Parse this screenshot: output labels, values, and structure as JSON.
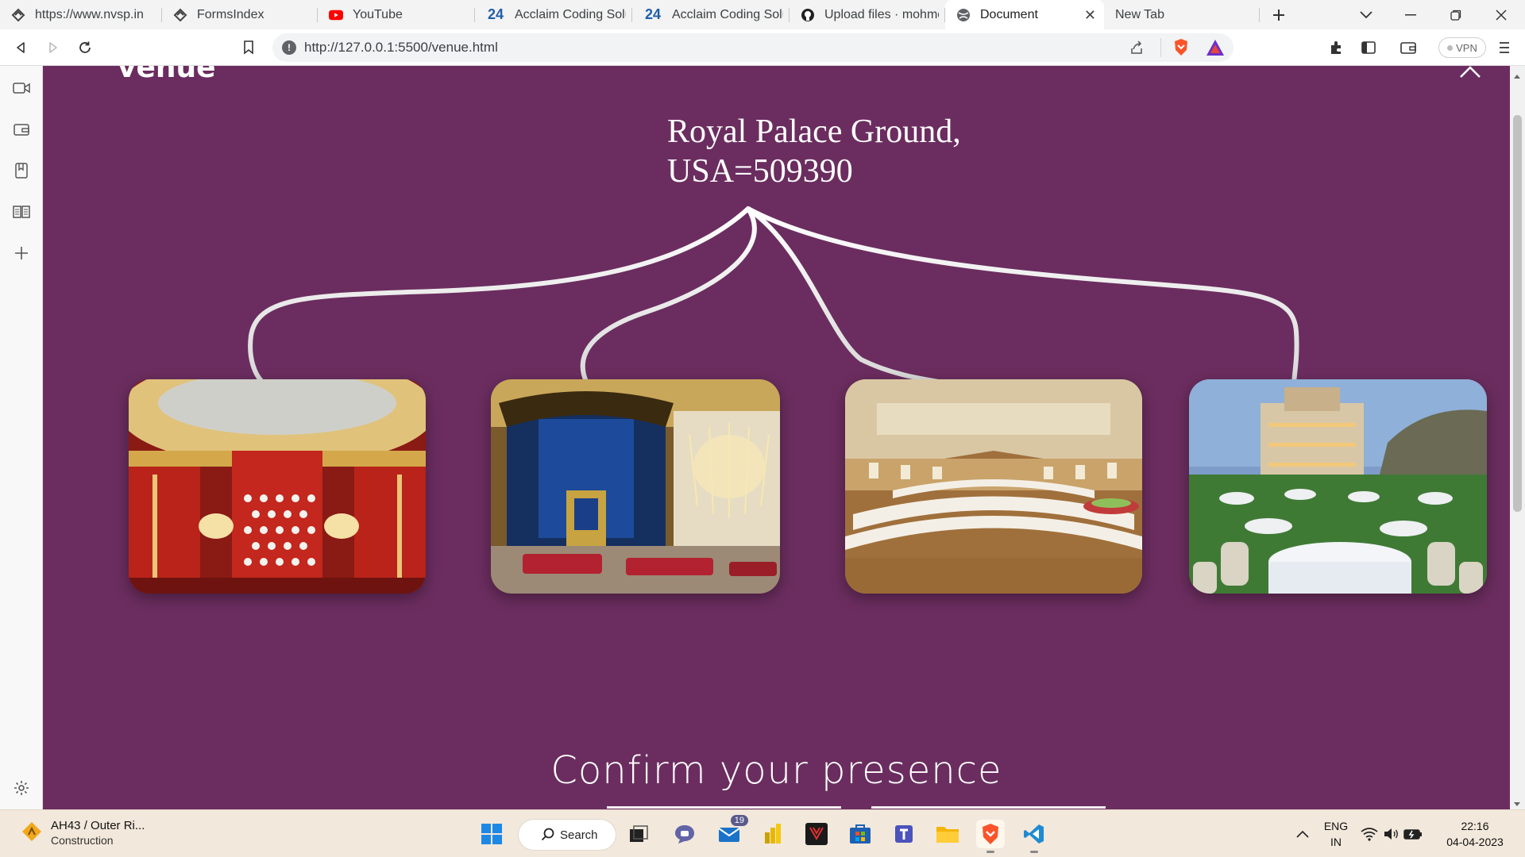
{
  "browser": {
    "tabs": [
      {
        "title": "https://www.nvsp.in",
        "icon": "nvsp-favicon",
        "active": false
      },
      {
        "title": "FormsIndex",
        "icon": "nvsp-favicon",
        "active": false
      },
      {
        "title": "YouTube",
        "icon": "youtube-favicon",
        "active": false
      },
      {
        "title": "Acclaim Coding Solutio",
        "icon": "24-favicon",
        "icon_text": "24",
        "active": false
      },
      {
        "title": "Acclaim Coding Solutio",
        "icon": "24-favicon",
        "icon_text": "24",
        "active": false
      },
      {
        "title": "Upload files · mohmoh",
        "icon": "github-favicon",
        "active": false
      },
      {
        "title": "Document",
        "icon": "globe-favicon",
        "active": true
      },
      {
        "title": "New Tab",
        "icon": "",
        "active": false
      }
    ],
    "url": "http://127.0.0.1:5500/venue.html",
    "vpn_label": "VPN"
  },
  "page": {
    "heading": "venue",
    "address_line1": "Royal Palace Ground,",
    "address_line2": "USA=509390",
    "photos": [
      "throne-room-red",
      "throne-room-blue",
      "banquet-hall",
      "outdoor-garden-venue"
    ],
    "confirm_heading": "Confirm your presence",
    "colors": {
      "background": "#6b2d5f",
      "text": "#ffffff"
    }
  },
  "taskbar": {
    "weather_title": "AH43 / Outer Ri...",
    "weather_subtitle": "Construction",
    "search_label": "Search",
    "mail_badge": "19",
    "lang_line1": "ENG",
    "lang_line2": "IN",
    "time": "22:16",
    "date": "04-04-2023"
  }
}
